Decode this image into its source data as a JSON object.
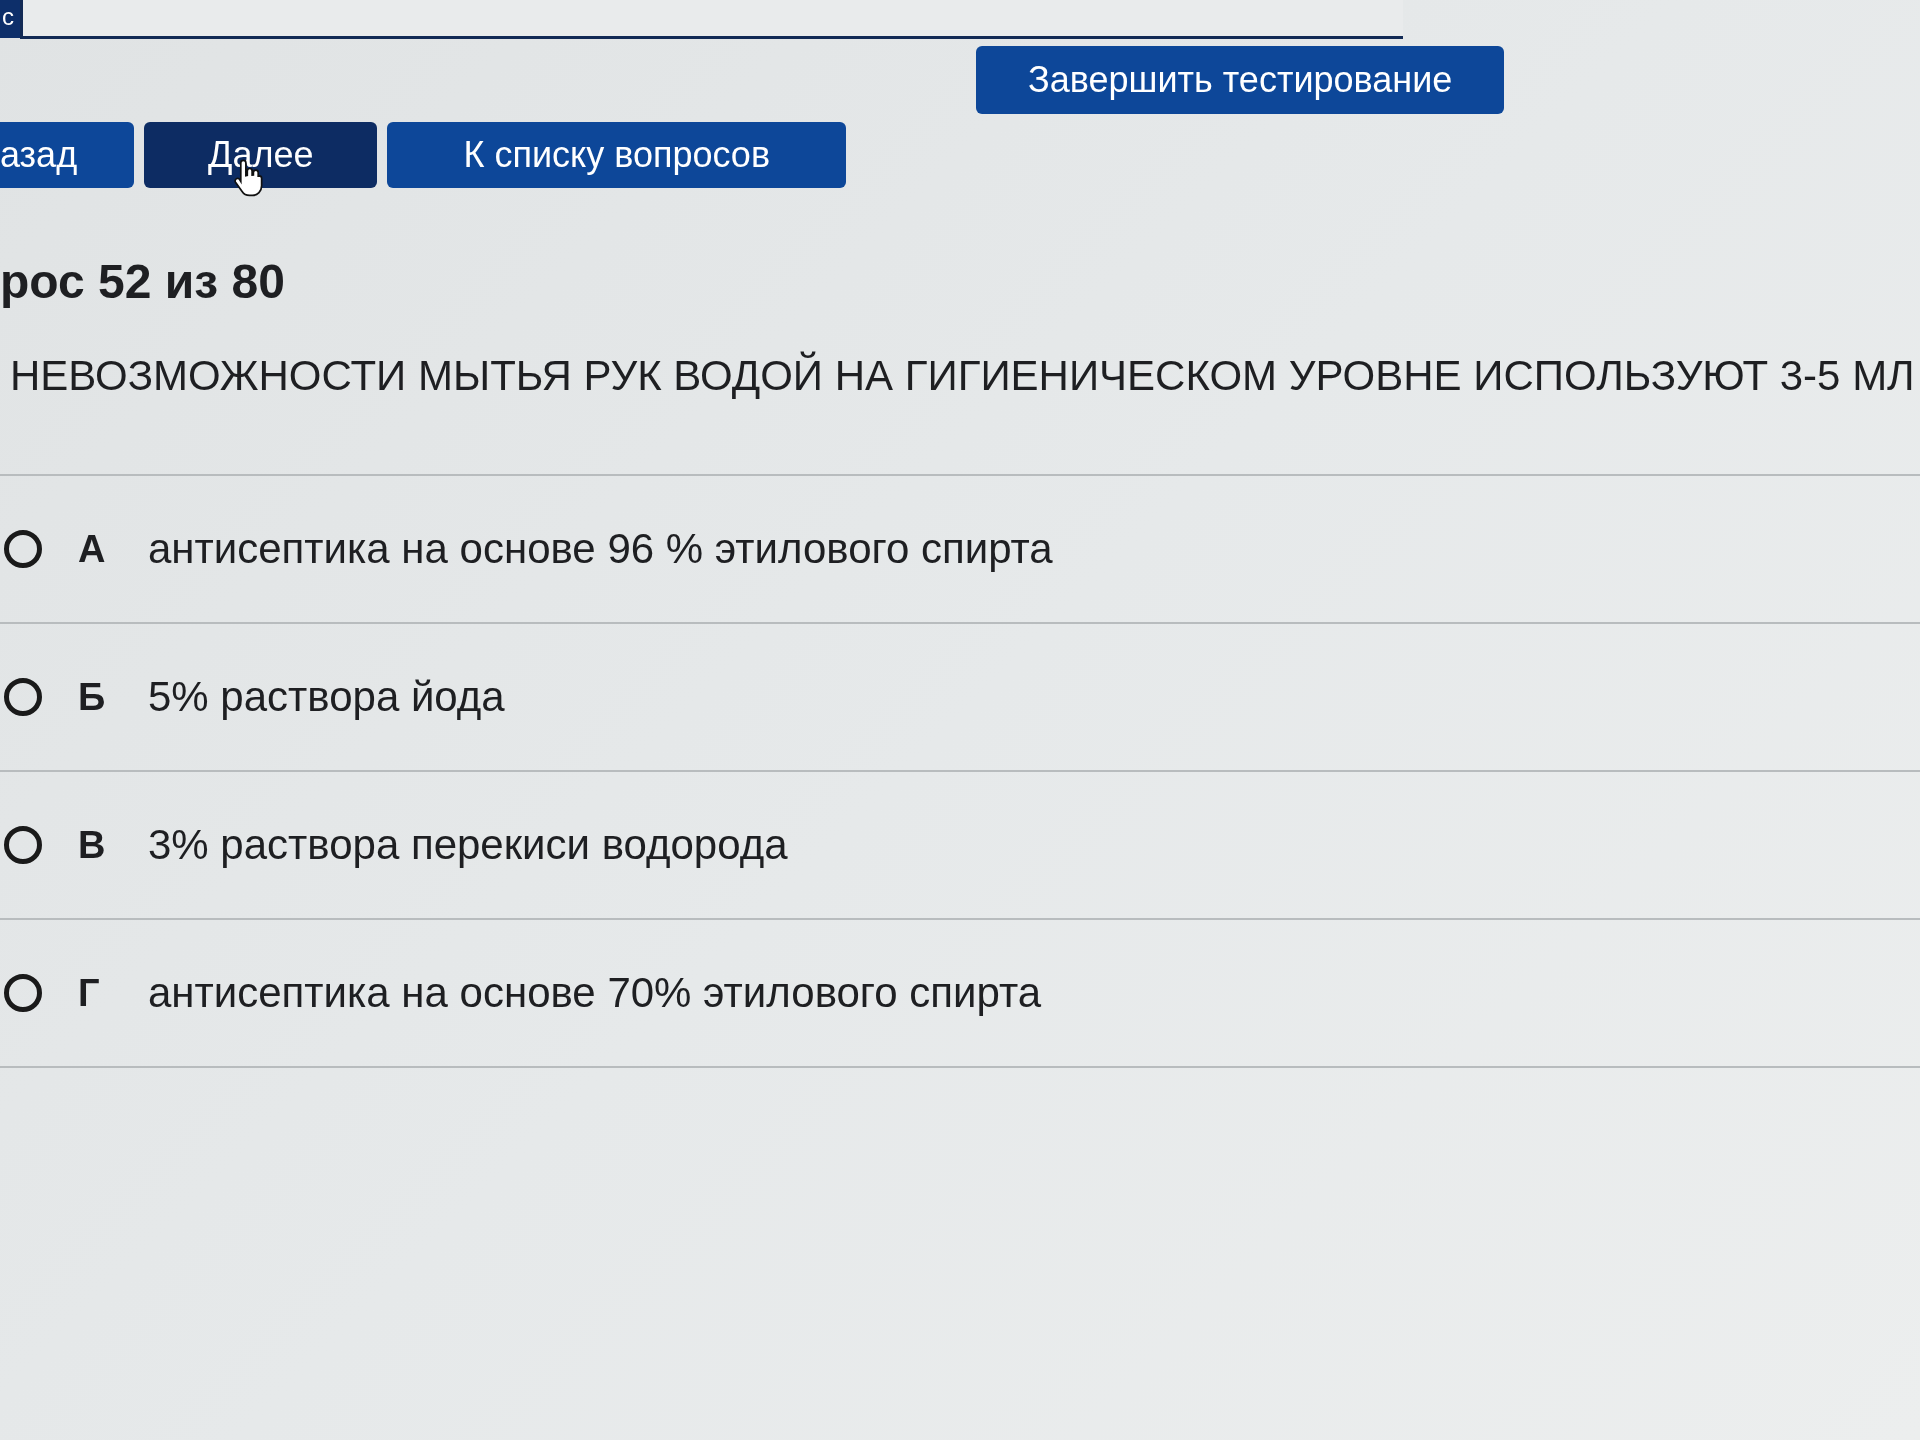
{
  "top_panel": {
    "tab_label": "с"
  },
  "nav_buttons": [
    {
      "label": "азад",
      "hovered": false
    },
    {
      "label": "Далее",
      "hovered": true
    },
    {
      "label": "К списку вопросов",
      "hovered": false
    }
  ],
  "finish_button": {
    "label": "Завершить тестирование"
  },
  "question": {
    "title": "рос 52 из 80",
    "text": "НЕВОЗМОЖНОСТИ МЫТЬЯ РУК ВОДОЙ НА ГИГИЕНИЧЕСКОМ УРОВНЕ ИСПОЛЬЗУЮТ 3-5 МЛ"
  },
  "options": [
    {
      "letter": "А",
      "text": "антисептика на основе 96 % этилового спирта",
      "selected": false
    },
    {
      "letter": "Б",
      "text": "5% раствора йода",
      "selected": false
    },
    {
      "letter": "В",
      "text": "3% раствора перекиси водорода",
      "selected": false
    },
    {
      "letter": "Г",
      "text": "антисептика на основе 70% этилового спирта",
      "selected": false
    }
  ]
}
